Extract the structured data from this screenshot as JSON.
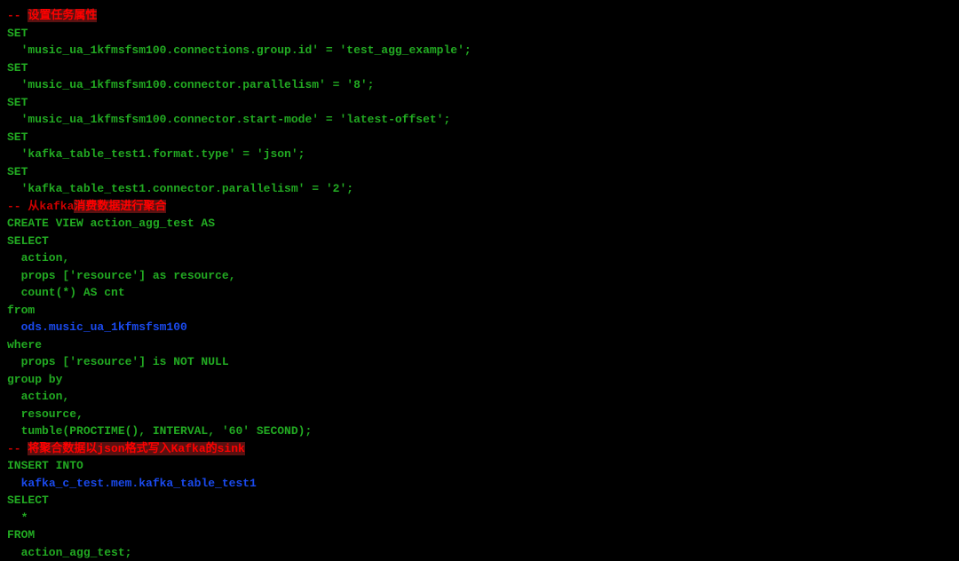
{
  "lines": [
    {
      "spans": [
        {
          "t": "-- ",
          "c": "comment"
        },
        {
          "t": "设置任务属性",
          "c": "comment-highlight"
        }
      ]
    },
    {
      "spans": [
        {
          "t": "SET",
          "c": "keyword"
        }
      ]
    },
    {
      "spans": [
        {
          "t": "  'music_ua_1kfmsfsm100.connections.group.id' = 'test_agg_example';",
          "c": "normal"
        }
      ]
    },
    {
      "spans": [
        {
          "t": "SET",
          "c": "keyword"
        }
      ]
    },
    {
      "spans": [
        {
          "t": "  'music_ua_1kfmsfsm100.connector.parallelism' = '8';",
          "c": "normal"
        }
      ]
    },
    {
      "spans": [
        {
          "t": "SET",
          "c": "keyword"
        }
      ]
    },
    {
      "spans": [
        {
          "t": "  'music_ua_1kfmsfsm100.connector.start-mode' = 'latest-offset';",
          "c": "normal"
        }
      ]
    },
    {
      "spans": [
        {
          "t": "SET",
          "c": "keyword"
        }
      ]
    },
    {
      "spans": [
        {
          "t": "  'kafka_table_test1.format.type' = 'json';",
          "c": "normal"
        }
      ]
    },
    {
      "spans": [
        {
          "t": "SET",
          "c": "keyword"
        }
      ]
    },
    {
      "spans": [
        {
          "t": "  'kafka_table_test1.connector.parallelism' = '2';",
          "c": "normal"
        }
      ]
    },
    {
      "spans": [
        {
          "t": "-- 从kafka",
          "c": "comment"
        },
        {
          "t": "消费数据进行聚合",
          "c": "comment-highlight"
        }
      ]
    },
    {
      "spans": [
        {
          "t": "CREATE VIEW action_agg_test AS",
          "c": "keyword"
        }
      ]
    },
    {
      "spans": [
        {
          "t": "SELECT",
          "c": "keyword"
        }
      ]
    },
    {
      "spans": [
        {
          "t": "  action,",
          "c": "normal"
        }
      ]
    },
    {
      "spans": [
        {
          "t": "  props ['resource'] as resource,",
          "c": "normal"
        }
      ]
    },
    {
      "spans": [
        {
          "t": "  count(*) AS cnt",
          "c": "normal"
        }
      ]
    },
    {
      "spans": [
        {
          "t": "from",
          "c": "keyword"
        }
      ]
    },
    {
      "spans": [
        {
          "t": "  ",
          "c": "normal"
        },
        {
          "t": "ods.music_ua_1kfmsfsm100",
          "c": "identifier"
        }
      ]
    },
    {
      "spans": [
        {
          "t": "where",
          "c": "keyword"
        }
      ]
    },
    {
      "spans": [
        {
          "t": "  props ['resource'] is NOT NULL",
          "c": "normal"
        }
      ]
    },
    {
      "spans": [
        {
          "t": "group by",
          "c": "keyword"
        }
      ]
    },
    {
      "spans": [
        {
          "t": "  action,",
          "c": "normal"
        }
      ]
    },
    {
      "spans": [
        {
          "t": "  resource,",
          "c": "normal"
        }
      ]
    },
    {
      "spans": [
        {
          "t": "  tumble(PROCTIME(), INTERVAL, '60' SECOND);",
          "c": "normal"
        }
      ]
    },
    {
      "spans": [
        {
          "t": "-- ",
          "c": "comment"
        },
        {
          "t": "将聚合数据以json格式写入Kafka的sink",
          "c": "comment-highlight"
        }
      ]
    },
    {
      "spans": [
        {
          "t": "INSERT INTO",
          "c": "keyword"
        }
      ]
    },
    {
      "spans": [
        {
          "t": "  ",
          "c": "normal"
        },
        {
          "t": "kafka_c_test.mem.kafka_table_test1",
          "c": "identifier"
        }
      ]
    },
    {
      "spans": [
        {
          "t": "SELECT",
          "c": "keyword"
        }
      ]
    },
    {
      "spans": [
        {
          "t": "  *",
          "c": "normal"
        }
      ]
    },
    {
      "spans": [
        {
          "t": "FROM",
          "c": "keyword"
        }
      ]
    },
    {
      "spans": [
        {
          "t": "  action_agg_test;",
          "c": "normal"
        }
      ]
    }
  ]
}
